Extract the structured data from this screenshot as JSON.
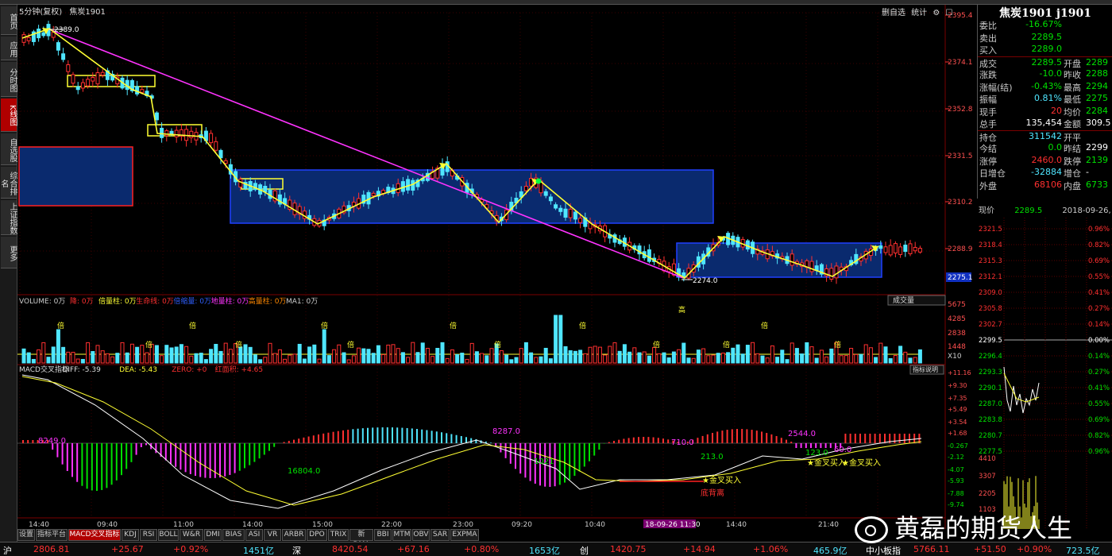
{
  "header": {
    "period": "5分钟(复权)",
    "symbol": "焦炭1901",
    "tool_self_select": "删自选",
    "tool_stats": "统计",
    "tool_gear": "⚙",
    "tool_close": "☐"
  },
  "left_nav": [
    {
      "label": "首页"
    },
    {
      "label": "应用"
    },
    {
      "label": "分时图"
    },
    {
      "label": "K线图",
      "active": true
    },
    {
      "label": "自选股"
    },
    {
      "label": "综合排名"
    },
    {
      "label": "上证指数"
    },
    {
      "label": "更多"
    }
  ],
  "price_axis": [
    "2395.4",
    "2374.1",
    "2352.8",
    "2331.5",
    "2310.2",
    "2288.9"
  ],
  "last_price_tag": "2275.1",
  "chart_labels": {
    "high": "2389.0",
    "low": "2274.0"
  },
  "volume_header": {
    "volume": "VOLUME: 0万",
    "down": "降: 0万",
    "double": "倍量柱: 0万",
    "life": "生命线: 0万",
    "double2": "倍缩量: 0万",
    "ground": "地量柱: 0万",
    "high": "高量柱: 0万",
    "ma1": "MA1: 0万",
    "dropdown": "成交量"
  },
  "volume_axis": [
    "5675",
    "4285",
    "2838",
    "1448",
    "X10"
  ],
  "volume_marks": [
    "倍",
    "倍",
    "倍",
    "倍",
    "倍",
    "倍",
    "倍",
    "倍",
    "倍",
    "倍",
    "高",
    "倍",
    "倍",
    "倍"
  ],
  "macd_header": {
    "name": "MACD交叉指标",
    "diff": "DIFF: -5.39",
    "dea": "DEA: -5.43",
    "zero": "ZERO: +0",
    "red": "红面积: +4.65",
    "explain": "指标说明"
  },
  "macd_axis": [
    "+11.16",
    "+9.30",
    "+7.35",
    "+5.49",
    "+3.54",
    "+1.68",
    "-0.267",
    "-2.12",
    "-4.07",
    "-5.93",
    "-7.88",
    "-9.74"
  ],
  "macd_labels": {
    "a1": "8249.0",
    "a2": "16804.0",
    "a3": "8287.0",
    "a4": "1021",
    "a5": "710.0",
    "a6": "213.0",
    "a7": "2544.0",
    "a8": "123.0",
    "a9": "60.0",
    "cross1": "★金叉买入",
    "cross2": "★金叉买入",
    "cross3": "★金叉买入",
    "divergence": "底背离"
  },
  "time_axis": [
    "14:40",
    "09:40",
    "11:00",
    "14:00",
    "15:00",
    "22:00",
    "23:00",
    "09:20",
    "10:40",
    "18-09-26 11:30",
    "14:40",
    "21:40"
  ],
  "quote": {
    "title": "焦炭1901 j1901",
    "rows": [
      {
        "l1": "委比",
        "v1": "-16.67%",
        "c1": "green",
        "l2": "",
        "v2": "",
        "c2": ""
      },
      {
        "l1": "卖出",
        "v1": "2289.5",
        "c1": "green",
        "l2": "",
        "v2": "",
        "c2": ""
      },
      {
        "l1": "买入",
        "v1": "2289.0",
        "c1": "green",
        "l2": "",
        "v2": "",
        "c2": ""
      },
      {
        "l1": "成交",
        "v1": "2289.5",
        "c1": "green",
        "l2": "开盘",
        "v2": "2289",
        "c2": "green"
      },
      {
        "l1": "涨跌",
        "v1": "-10.0",
        "c1": "green",
        "l2": "昨收",
        "v2": "2288",
        "c2": "green"
      },
      {
        "l1": "涨幅(结)",
        "v1": "-0.43%",
        "c1": "green",
        "l2": "最高",
        "v2": "2294",
        "c2": "green"
      },
      {
        "l1": "振幅",
        "v1": "0.81%",
        "c1": "cyan",
        "l2": "最低",
        "v2": "2275",
        "c2": "green"
      },
      {
        "l1": "现手",
        "v1": "20",
        "c1": "red",
        "l2": "均价",
        "v2": "2284",
        "c2": "green"
      },
      {
        "l1": "总手",
        "v1": "135,454",
        "c1": "white",
        "l2": "金额",
        "v2": "309.5",
        "c2": "white"
      },
      {
        "l1": "持仓",
        "v1": "311542",
        "c1": "cyan",
        "l2": "开平",
        "v2": "",
        "c2": "white"
      },
      {
        "l1": "今结",
        "v1": "0.0",
        "c1": "green",
        "l2": "昨结",
        "v2": "2299",
        "c2": "white"
      },
      {
        "l1": "涨停",
        "v1": "2460.0",
        "c1": "red",
        "l2": "跌停",
        "v2": "2139",
        "c2": "green"
      },
      {
        "l1": "日增仓",
        "v1": "-32884",
        "c1": "cyan",
        "l2": "增仓",
        "v2": "-",
        "c2": "white"
      },
      {
        "l1": "外盘",
        "v1": "68106",
        "c1": "red",
        "l2": "内盘",
        "v2": "6733",
        "c2": "green"
      }
    ],
    "now_label": "现价",
    "now_price": "2289.5",
    "now_date": "2018-09-26,"
  },
  "intraday_axis": [
    {
      "l": "2321.5",
      "r": "0.96%",
      "lc": "red",
      "rc": "red"
    },
    {
      "l": "2318.4",
      "r": "0.82%",
      "lc": "red",
      "rc": "red"
    },
    {
      "l": "2315.3",
      "r": "0.69%",
      "lc": "red",
      "rc": "red"
    },
    {
      "l": "2312.1",
      "r": "0.55%",
      "lc": "red",
      "rc": "red"
    },
    {
      "l": "2309.0",
      "r": "0.41%",
      "lc": "red",
      "rc": "red"
    },
    {
      "l": "2305.8",
      "r": "0.27%",
      "lc": "red",
      "rc": "red"
    },
    {
      "l": "2302.7",
      "r": "0.14%",
      "lc": "red",
      "rc": "red"
    },
    {
      "l": "2299.5",
      "r": "0.00%",
      "lc": "white",
      "rc": "white"
    },
    {
      "l": "2296.4",
      "r": "0.14%",
      "lc": "green",
      "rc": "green"
    },
    {
      "l": "2293.3",
      "r": "0.27%",
      "lc": "green",
      "rc": "green"
    },
    {
      "l": "2290.1",
      "r": "0.41%",
      "lc": "green",
      "rc": "green"
    },
    {
      "l": "2287.0",
      "r": "0.55%",
      "lc": "green",
      "rc": "green"
    },
    {
      "l": "2283.8",
      "r": "0.69%",
      "lc": "green",
      "rc": "green"
    },
    {
      "l": "2280.7",
      "r": "0.82%",
      "lc": "green",
      "rc": "green"
    },
    {
      "l": "2277.5",
      "r": "0.96%",
      "lc": "green",
      "rc": "green"
    }
  ],
  "intraday_vol_axis": [
    "4410",
    "3307",
    "2205",
    "1103"
  ],
  "bottom_tabs": [
    "设置",
    "指标平台",
    "MACD交叉指标",
    "KDJ",
    "RSI",
    "BOLL",
    "W&R",
    "DMI",
    "BIAS",
    "ASI",
    "VR",
    "ARBR",
    "DPO",
    "TRIX",
    "新DMA",
    "BBI",
    "MTM",
    "OBV",
    "SAR",
    "EXPMA"
  ],
  "status": {
    "sh": "沪",
    "sh_index": "2806.81",
    "sh_chg": "+25.67",
    "sh_pct": "+0.92%",
    "sh_amt": "1451亿",
    "sz": "深",
    "sz_index": "8420.54",
    "sz_chg": "+67.16",
    "sz_pct": "+0.80%",
    "sz_amt": "1653亿",
    "cy": "创",
    "cy_index": "1420.75",
    "cy_chg": "+14.94",
    "cy_pct": "+1.06%",
    "cy_amt": "465.9亿",
    "zx": "中小板指",
    "zx_index": "5766.11",
    "right_pct": "+0.90%",
    "right_amt": "723.5亿",
    "right_chg": "+51.50"
  },
  "watermark": "黄磊的期货人生"
}
